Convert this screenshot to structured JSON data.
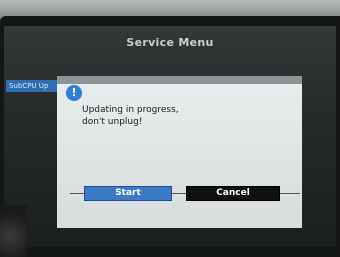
{
  "header": {
    "title": "Service Menu"
  },
  "sidebar": {
    "items": [
      {
        "label": "SubCPU Up"
      }
    ]
  },
  "dialog": {
    "icon": "info-icon",
    "icon_glyph": "!",
    "message_line1": "Updating in progress,",
    "message_line2": "don't unplug!",
    "buttons": {
      "start_label": "Start",
      "cancel_label": "Cancel"
    }
  }
}
